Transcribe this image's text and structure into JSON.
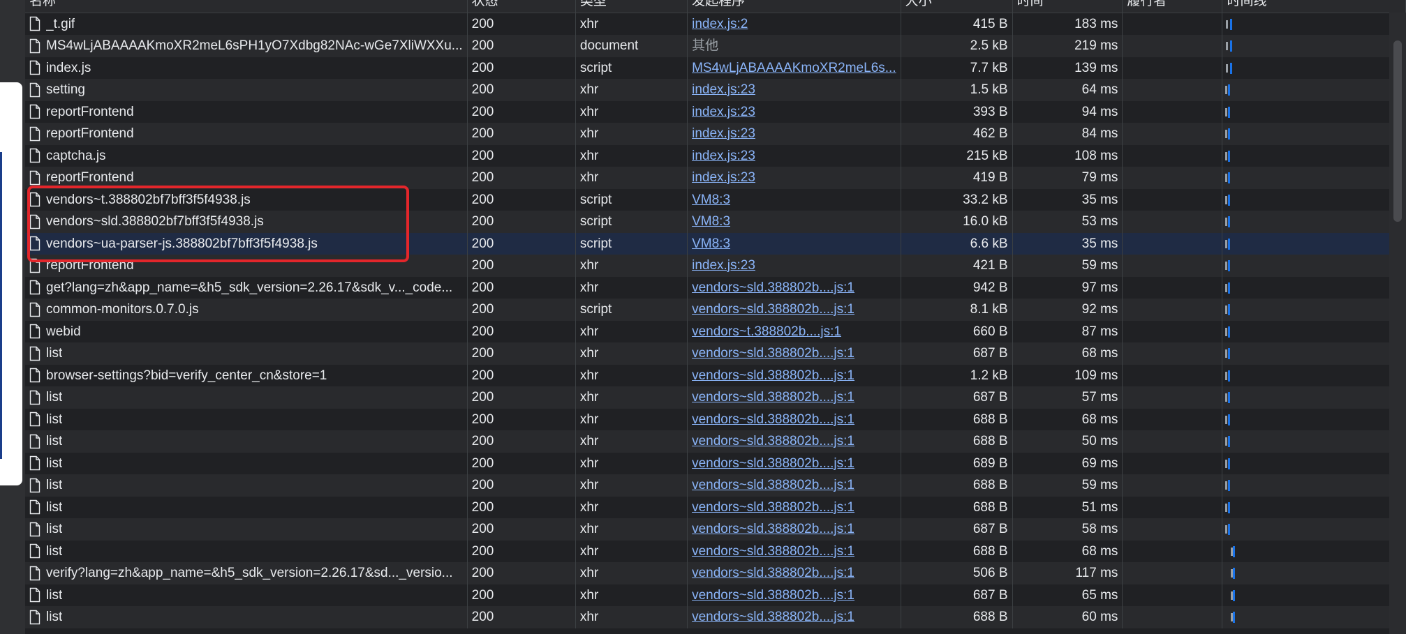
{
  "columns": {
    "name": "名称",
    "status": "状态",
    "type": "类型",
    "initiator": "发起程序",
    "size": "大小",
    "time": "时间",
    "priority": "履行者",
    "waterfall": "时间线"
  },
  "rows": [
    {
      "name": "_t.gif",
      "status": "200",
      "type": "xhr",
      "initiator": "index.js:2",
      "initiator_link": true,
      "size": "415 B",
      "time": "183 ms"
    },
    {
      "name": "MS4wLjABAAAAKmoXR2meL6sPH1yO7Xdbg82NAc-wGe7XliWXXu...",
      "status": "200",
      "type": "document",
      "initiator": "其他",
      "initiator_link": false,
      "size": "2.5 kB",
      "time": "219 ms"
    },
    {
      "name": "index.js",
      "status": "200",
      "type": "script",
      "initiator": "MS4wLjABAAAAKmoXR2meL6s...",
      "initiator_link": true,
      "size": "7.7 kB",
      "time": "139 ms"
    },
    {
      "name": "setting",
      "status": "200",
      "type": "xhr",
      "initiator": "index.js:23",
      "initiator_link": true,
      "size": "1.5 kB",
      "time": "64 ms"
    },
    {
      "name": "reportFrontend",
      "status": "200",
      "type": "xhr",
      "initiator": "index.js:23",
      "initiator_link": true,
      "size": "393 B",
      "time": "94 ms"
    },
    {
      "name": "reportFrontend",
      "status": "200",
      "type": "xhr",
      "initiator": "index.js:23",
      "initiator_link": true,
      "size": "462 B",
      "time": "84 ms"
    },
    {
      "name": "captcha.js",
      "status": "200",
      "type": "xhr",
      "initiator": "index.js:23",
      "initiator_link": true,
      "size": "215 kB",
      "time": "108 ms"
    },
    {
      "name": "reportFrontend",
      "status": "200",
      "type": "xhr",
      "initiator": "index.js:23",
      "initiator_link": true,
      "size": "419 B",
      "time": "79 ms"
    },
    {
      "name": "vendors~t.388802bf7bff3f5f4938.js",
      "status": "200",
      "type": "script",
      "initiator": "VM8:3",
      "initiator_link": true,
      "size": "33.2 kB",
      "time": "35 ms"
    },
    {
      "name": "vendors~sld.388802bf7bff3f5f4938.js",
      "status": "200",
      "type": "script",
      "initiator": "VM8:3",
      "initiator_link": true,
      "size": "16.0 kB",
      "time": "53 ms"
    },
    {
      "name": "vendors~ua-parser-js.388802bf7bff3f5f4938.js",
      "status": "200",
      "type": "script",
      "initiator": "VM8:3",
      "initiator_link": true,
      "size": "6.6 kB",
      "time": "35 ms",
      "selected": true
    },
    {
      "name": "reportFrontend",
      "status": "200",
      "type": "xhr",
      "initiator": "index.js:23",
      "initiator_link": true,
      "size": "421 B",
      "time": "59 ms"
    },
    {
      "name": "get?lang=zh&app_name=&h5_sdk_version=2.26.17&sdk_v..._code...",
      "status": "200",
      "type": "xhr",
      "initiator": "vendors~sld.388802b....js:1",
      "initiator_link": true,
      "size": "942 B",
      "time": "97 ms"
    },
    {
      "name": "common-monitors.0.7.0.js",
      "status": "200",
      "type": "script",
      "initiator": "vendors~sld.388802b....js:1",
      "initiator_link": true,
      "size": "8.1 kB",
      "time": "92 ms"
    },
    {
      "name": "webid",
      "status": "200",
      "type": "xhr",
      "initiator": "vendors~t.388802b....js:1",
      "initiator_link": true,
      "size": "660 B",
      "time": "87 ms"
    },
    {
      "name": "list",
      "status": "200",
      "type": "xhr",
      "initiator": "vendors~sld.388802b....js:1",
      "initiator_link": true,
      "size": "687 B",
      "time": "68 ms"
    },
    {
      "name": "browser-settings?bid=verify_center_cn&store=1",
      "status": "200",
      "type": "xhr",
      "initiator": "vendors~sld.388802b....js:1",
      "initiator_link": true,
      "size": "1.2 kB",
      "time": "109 ms"
    },
    {
      "name": "list",
      "status": "200",
      "type": "xhr",
      "initiator": "vendors~sld.388802b....js:1",
      "initiator_link": true,
      "size": "687 B",
      "time": "57 ms"
    },
    {
      "name": "list",
      "status": "200",
      "type": "xhr",
      "initiator": "vendors~sld.388802b....js:1",
      "initiator_link": true,
      "size": "688 B",
      "time": "68 ms"
    },
    {
      "name": "list",
      "status": "200",
      "type": "xhr",
      "initiator": "vendors~sld.388802b....js:1",
      "initiator_link": true,
      "size": "688 B",
      "time": "50 ms"
    },
    {
      "name": "list",
      "status": "200",
      "type": "xhr",
      "initiator": "vendors~sld.388802b....js:1",
      "initiator_link": true,
      "size": "689 B",
      "time": "69 ms"
    },
    {
      "name": "list",
      "status": "200",
      "type": "xhr",
      "initiator": "vendors~sld.388802b....js:1",
      "initiator_link": true,
      "size": "688 B",
      "time": "59 ms"
    },
    {
      "name": "list",
      "status": "200",
      "type": "xhr",
      "initiator": "vendors~sld.388802b....js:1",
      "initiator_link": true,
      "size": "688 B",
      "time": "51 ms"
    },
    {
      "name": "list",
      "status": "200",
      "type": "xhr",
      "initiator": "vendors~sld.388802b....js:1",
      "initiator_link": true,
      "size": "687 B",
      "time": "58 ms"
    },
    {
      "name": "list",
      "status": "200",
      "type": "xhr",
      "initiator": "vendors~sld.388802b....js:1",
      "initiator_link": true,
      "size": "688 B",
      "time": "68 ms"
    },
    {
      "name": "verify?lang=zh&app_name=&h5_sdk_version=2.26.17&sd..._versio...",
      "status": "200",
      "type": "xhr",
      "initiator": "vendors~sld.388802b....js:1",
      "initiator_link": true,
      "size": "506 B",
      "time": "117 ms"
    },
    {
      "name": "list",
      "status": "200",
      "type": "xhr",
      "initiator": "vendors~sld.388802b....js:1",
      "initiator_link": true,
      "size": "687 B",
      "time": "65 ms"
    },
    {
      "name": "list",
      "status": "200",
      "type": "xhr",
      "initiator": "vendors~sld.388802b....js:1",
      "initiator_link": true,
      "size": "688 B",
      "time": "60 ms"
    }
  ],
  "colors": {
    "background": "#202124",
    "link": "#8ab4f8",
    "waterfall_blue": "#1a73e8",
    "highlight_border": "#e3262b",
    "selected_row": "#1f2b44"
  },
  "icons": {
    "file": "file-icon"
  }
}
